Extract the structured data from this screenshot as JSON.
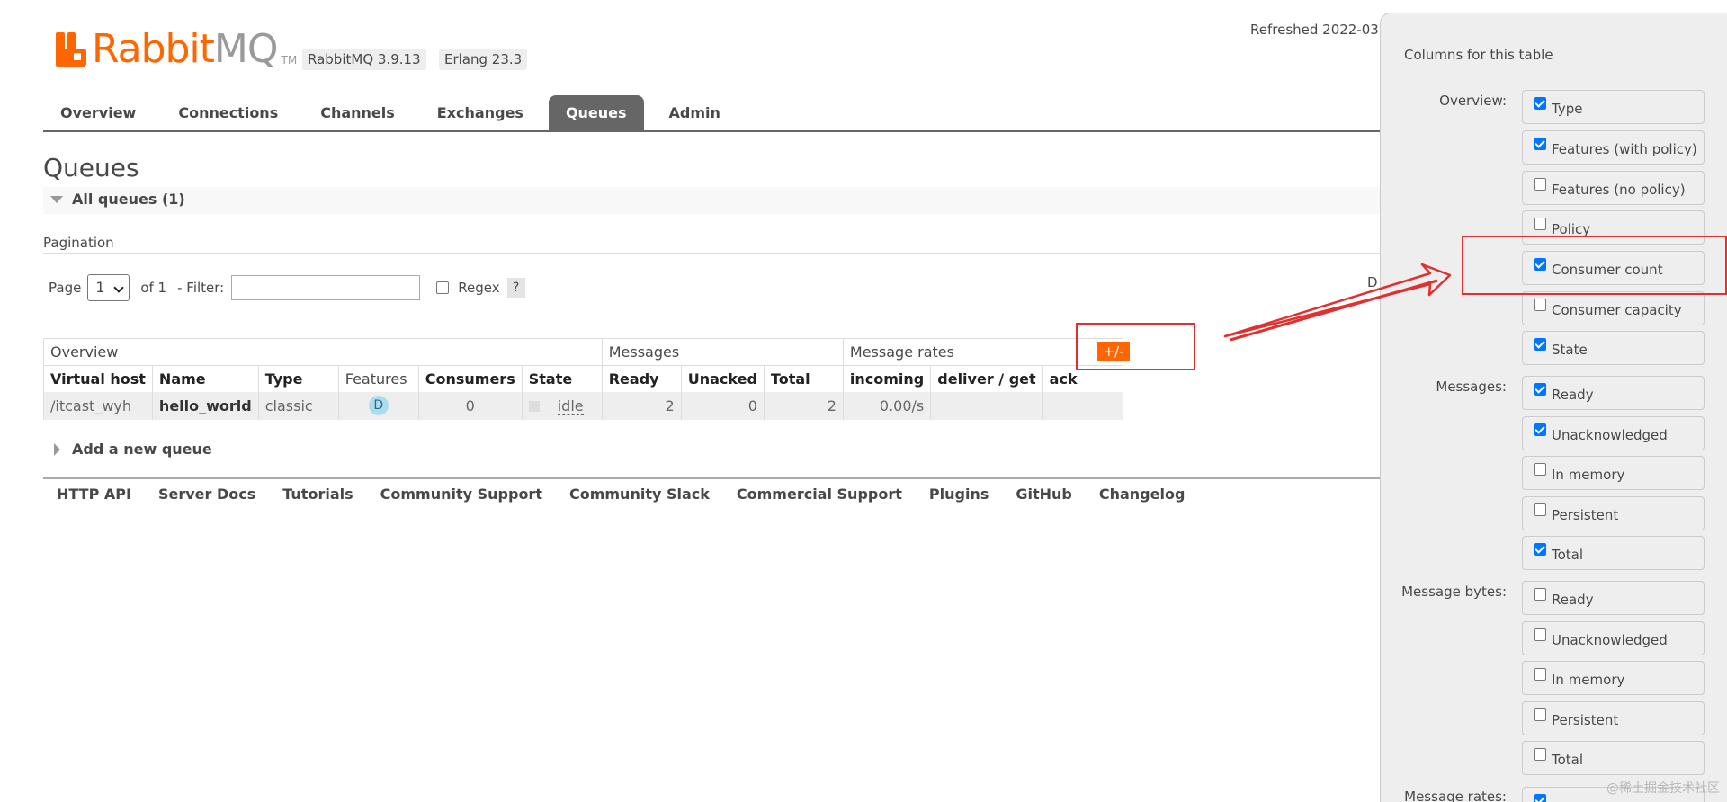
{
  "header": {
    "logo_primary": "Rabbit",
    "logo_secondary": "MQ",
    "logo_tm": "TM",
    "version": "RabbitMQ 3.9.13",
    "erlang": "Erlang 23.3",
    "refreshed": "Refreshed 2022-03"
  },
  "tabs": [
    {
      "label": "Overview"
    },
    {
      "label": "Connections"
    },
    {
      "label": "Channels"
    },
    {
      "label": "Exchanges"
    },
    {
      "label": "Queues",
      "active": true
    },
    {
      "label": "Admin"
    }
  ],
  "page": {
    "title": "Queues",
    "section": "All queues (1)",
    "pagination_label": "Pagination",
    "page_label": "Page",
    "page_value": "1",
    "of_label": "of 1",
    "filter_label": "- Filter:",
    "filter_value": "",
    "regex_label": "Regex",
    "help": "?",
    "partial_right": "D"
  },
  "table": {
    "groups": [
      "Overview",
      "Messages",
      "Message rates"
    ],
    "columns": [
      "Virtual host",
      "Name",
      "Type",
      "Features",
      "Consumers",
      "State",
      "Ready",
      "Unacked",
      "Total",
      "incoming",
      "deliver / get",
      "ack"
    ],
    "rows": [
      {
        "vhost": "/itcast_wyh",
        "name": "hello_world",
        "type": "classic",
        "features": "D",
        "consumers": "0",
        "state": "idle",
        "ready": "2",
        "unacked": "0",
        "total": "2",
        "incoming": "0.00/s",
        "deliver_get": "",
        "ack": ""
      }
    ],
    "toggle_label": "+/-"
  },
  "add_queue": "Add a new queue",
  "footer": [
    "HTTP API",
    "Server Docs",
    "Tutorials",
    "Community Support",
    "Community Slack",
    "Commercial Support",
    "Plugins",
    "GitHub",
    "Changelog"
  ],
  "column_panel": {
    "title": "Columns for this table",
    "groups": [
      {
        "label": "Overview:",
        "items": [
          {
            "label": "Type",
            "checked": true
          },
          {
            "label": "Features (with policy)",
            "checked": true
          },
          {
            "label": "Features (no policy)",
            "checked": false
          },
          {
            "label": "Policy",
            "checked": false
          },
          {
            "label": "Consumer count",
            "checked": true
          },
          {
            "label": "Consumer capacity",
            "checked": false
          },
          {
            "label": "State",
            "checked": true
          }
        ]
      },
      {
        "label": "Messages:",
        "items": [
          {
            "label": "Ready",
            "checked": true
          },
          {
            "label": "Unacknowledged",
            "checked": true
          },
          {
            "label": "In memory",
            "checked": false
          },
          {
            "label": "Persistent",
            "checked": false
          },
          {
            "label": "Total",
            "checked": true
          }
        ]
      },
      {
        "label": "Message bytes:",
        "items": [
          {
            "label": "Ready",
            "checked": false
          },
          {
            "label": "Unacknowledged",
            "checked": false
          },
          {
            "label": "In memory",
            "checked": false
          },
          {
            "label": "Persistent",
            "checked": false
          },
          {
            "label": "Total",
            "checked": false
          }
        ]
      },
      {
        "label": "Message rates:",
        "items": [
          {
            "label": "",
            "checked": true
          }
        ]
      }
    ]
  },
  "watermark": "@稀土掘金技术社区",
  "colors": {
    "brand": "#ff6600",
    "tab_active": "#666666",
    "checkbox": "#0075ff",
    "annotation": "#e03030"
  }
}
